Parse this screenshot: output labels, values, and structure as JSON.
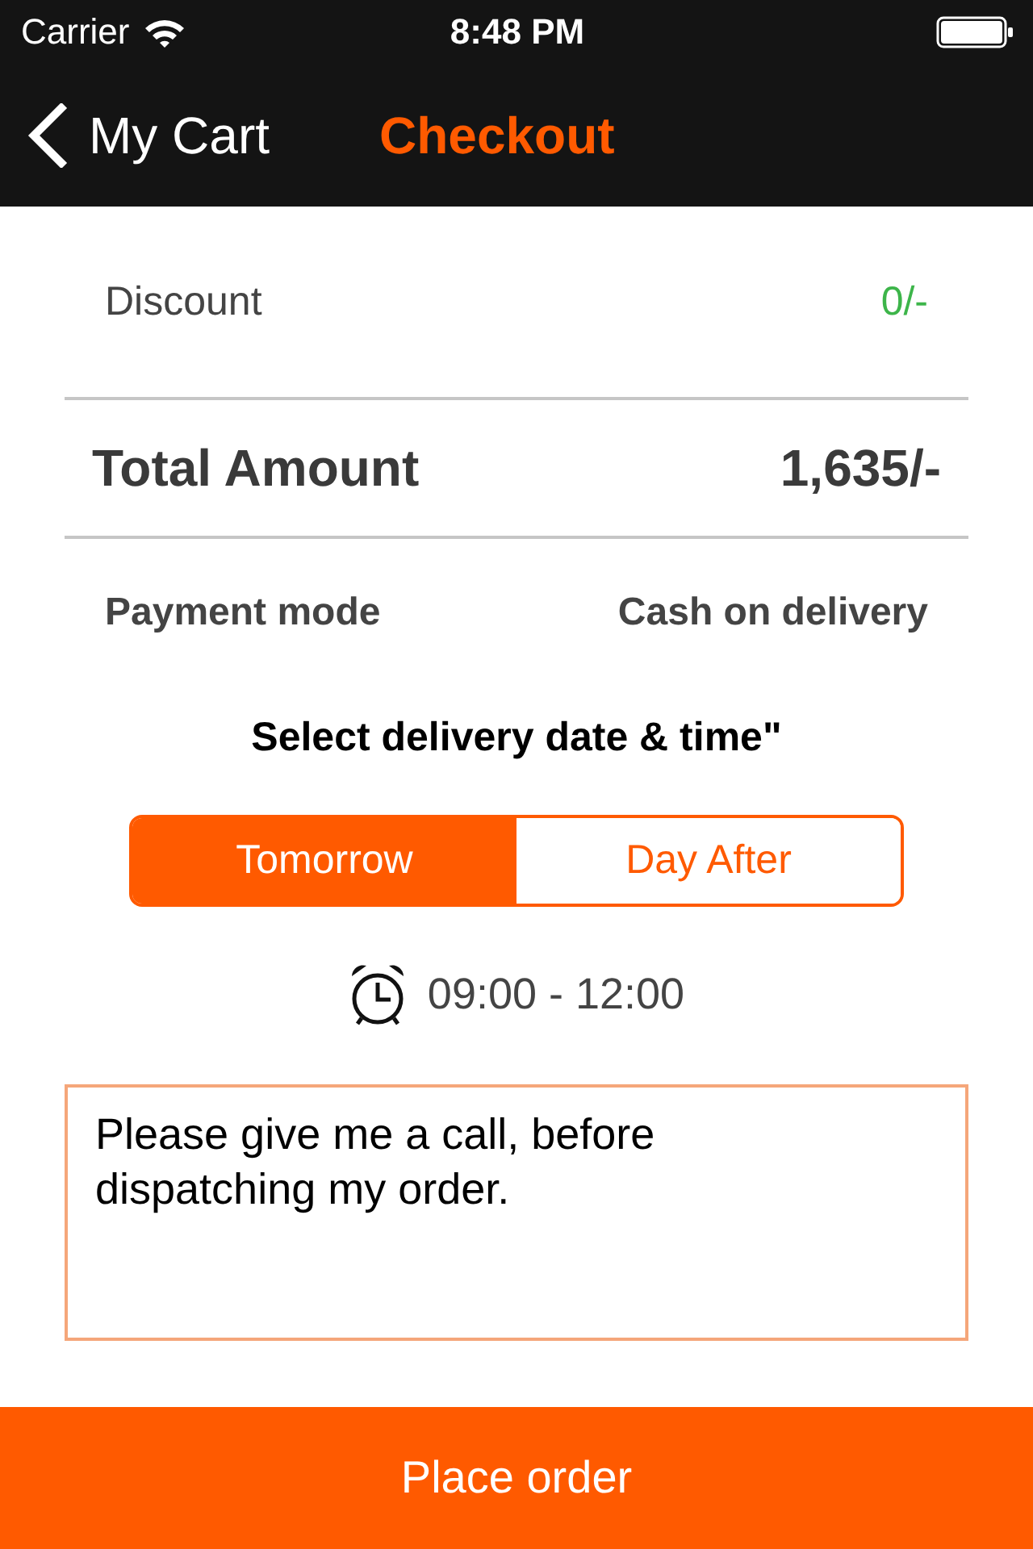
{
  "status_bar": {
    "carrier": "Carrier",
    "time": "8:48 PM"
  },
  "nav": {
    "back_label": "My Cart",
    "title": "Checkout"
  },
  "summary": [
    {
      "kind": "discount",
      "label": "Discount",
      "value": "0/-"
    },
    {
      "kind": "total",
      "label": "Total Amount",
      "value": "1,635/-"
    },
    {
      "kind": "payment",
      "label": "Payment mode",
      "value": "Cash on delivery"
    }
  ],
  "delivery": {
    "heading": "Select delivery date & time\"",
    "options": [
      {
        "label": "Tomorrow",
        "selected": true
      },
      {
        "label": "Day After",
        "selected": false
      }
    ],
    "time_slot": "09:00 - 12:00"
  },
  "note": {
    "value": "Please give me a call, before dispatching my order."
  },
  "place_order_button": "Place order"
}
